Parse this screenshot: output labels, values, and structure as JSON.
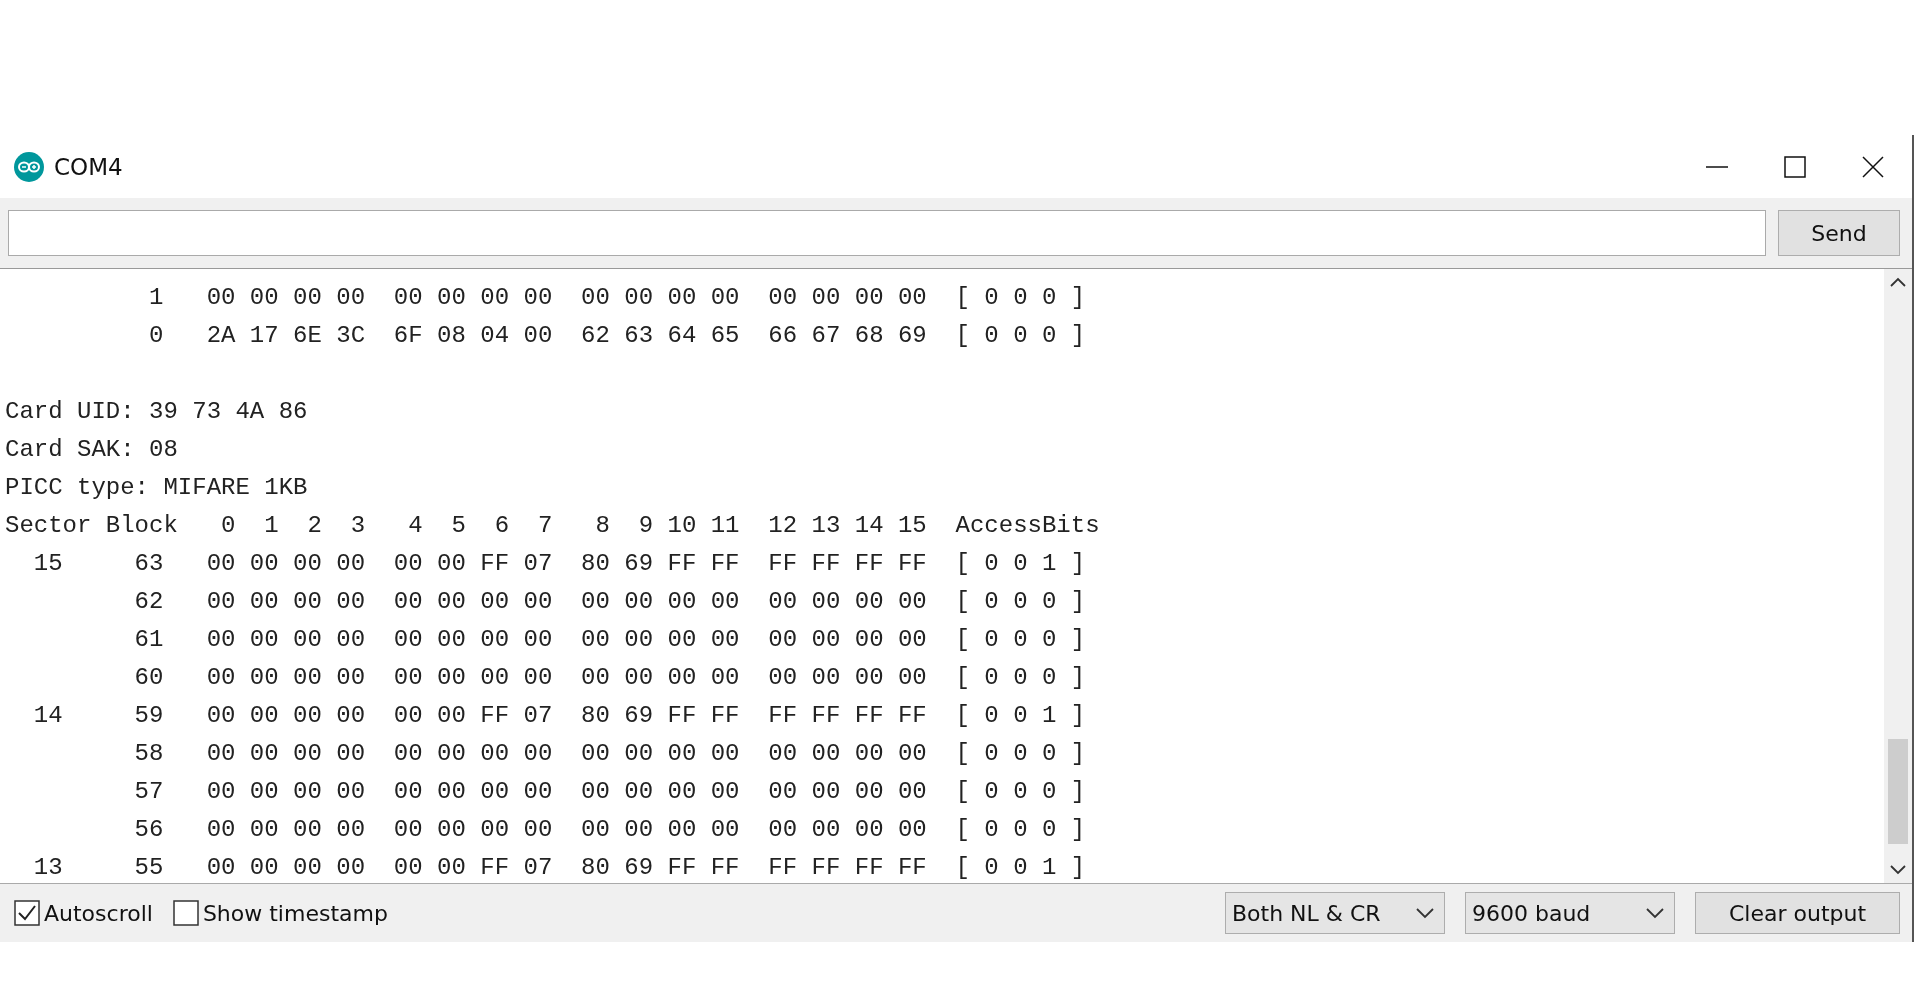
{
  "window": {
    "title": "COM4"
  },
  "send_button": "Send",
  "output_groups": [
    [
      "          1   00 00 00 00  00 00 00 00  00 00 00 00  00 00 00 00  [ 0 0 0 ]",
      "          0   2A 17 6E 3C  6F 08 04 00  62 63 64 65  66 67 68 69  [ 0 0 0 ]"
    ],
    [
      "Card UID: 39 73 4A 86",
      "Card SAK: 08",
      "PICC type: MIFARE 1KB",
      "Sector Block   0  1  2  3   4  5  6  7   8  9 10 11  12 13 14 15  AccessBits",
      "  15     63   00 00 00 00  00 00 FF 07  80 69 FF FF  FF FF FF FF  [ 0 0 1 ]",
      "         62   00 00 00 00  00 00 00 00  00 00 00 00  00 00 00 00  [ 0 0 0 ]",
      "         61   00 00 00 00  00 00 00 00  00 00 00 00  00 00 00 00  [ 0 0 0 ]",
      "         60   00 00 00 00  00 00 00 00  00 00 00 00  00 00 00 00  [ 0 0 0 ]",
      "  14     59   00 00 00 00  00 00 FF 07  80 69 FF FF  FF FF FF FF  [ 0 0 1 ]",
      "         58   00 00 00 00  00 00 00 00  00 00 00 00  00 00 00 00  [ 0 0 0 ]",
      "         57   00 00 00 00  00 00 00 00  00 00 00 00  00 00 00 00  [ 0 0 0 ]",
      "         56   00 00 00 00  00 00 00 00  00 00 00 00  00 00 00 00  [ 0 0 0 ]",
      "  13     55   00 00 00 00  00 00 FF 07  80 69 FF FF  FF FF FF FF  [ 0 0 1 ]"
    ]
  ],
  "autoscroll": {
    "label": "Autoscroll",
    "checked": true
  },
  "timestamp": {
    "label": "Show timestamp",
    "checked": false
  },
  "line_ending": "Both NL & CR",
  "baud": "9600 baud",
  "clear_button": "Clear output"
}
